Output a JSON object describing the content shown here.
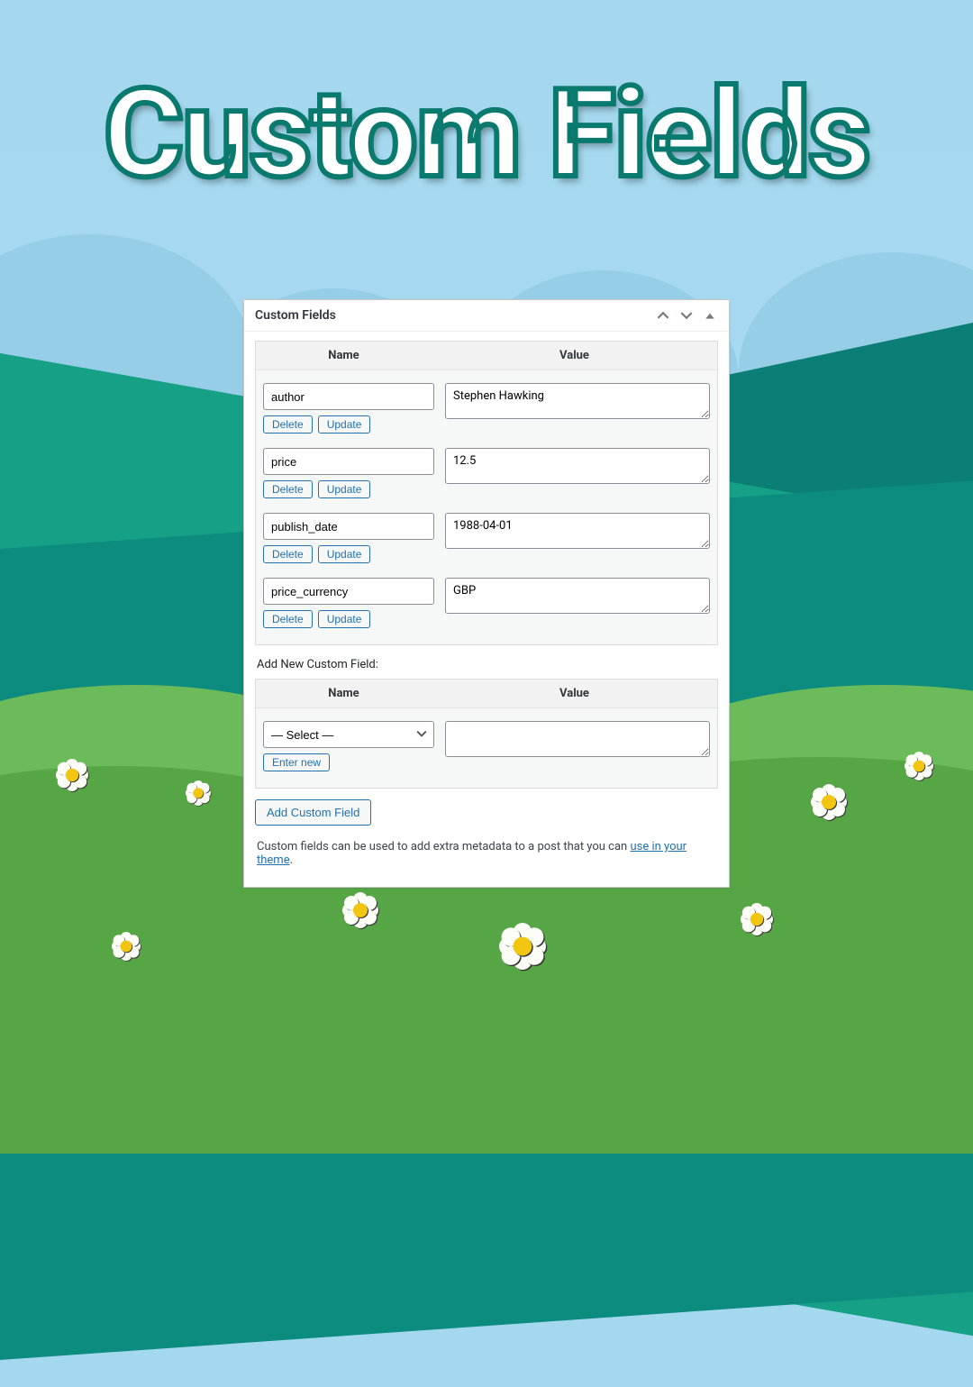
{
  "page_title": "Custom Fields",
  "panel": {
    "title": "Custom Fields",
    "columns": {
      "name": "Name",
      "value": "Value"
    },
    "buttons": {
      "delete": "Delete",
      "update": "Update",
      "enter_new": "Enter new",
      "add": "Add Custom Field"
    },
    "fields": [
      {
        "name": "author",
        "value": "Stephen Hawking"
      },
      {
        "name": "price",
        "value": "12.5"
      },
      {
        "name": "publish_date",
        "value": "1988-04-01"
      },
      {
        "name": "price_currency",
        "value": "GBP"
      }
    ],
    "add_new_label": "Add New Custom Field:",
    "select_placeholder": "— Select —",
    "footer_text": "Custom fields can be used to add extra metadata to a post that you can ",
    "footer_link": "use in your theme",
    "footer_suffix": "."
  }
}
